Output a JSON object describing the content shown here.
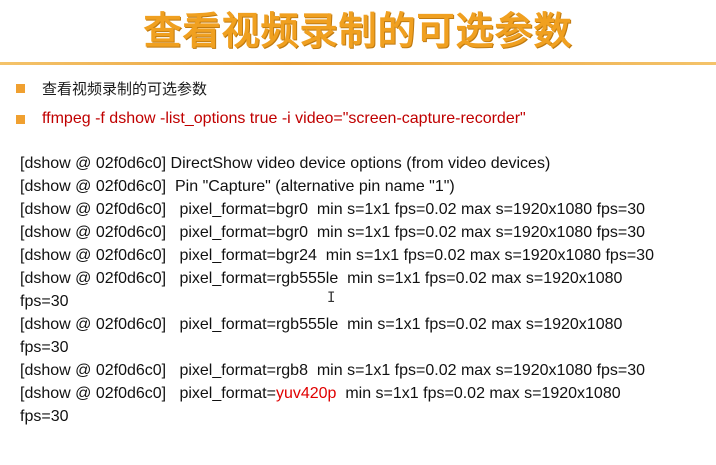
{
  "title": "查看视频录制的可选参数",
  "bullets": [
    "查看视频录制的可选参数",
    "ffmpeg -f dshow -list_options true -i video=\"screen-capture-recorder\""
  ],
  "output_lines": [
    "[dshow @ 02f0d6c0] DirectShow video device options (from video devices)",
    "[dshow @ 02f0d6c0]  Pin \"Capture\" (alternative pin name \"1\")",
    "[dshow @ 02f0d6c0]   pixel_format=bgr0  min s=1x1 fps=0.02 max s=1920x1080 fps=30",
    "[dshow @ 02f0d6c0]   pixel_format=bgr0  min s=1x1 fps=0.02 max s=1920x1080 fps=30",
    "[dshow @ 02f0d6c0]   pixel_format=bgr24  min s=1x1 fps=0.02 max s=1920x1080 fps=30",
    "[dshow @ 02f0d6c0]   pixel_format=rgb555le  min s=1x1 fps=0.02 max s=1920x1080",
    "fps=30",
    "[dshow @ 02f0d6c0]   pixel_format=rgb555le  min s=1x1 fps=0.02 max s=1920x1080",
    "fps=30",
    "[dshow @ 02f0d6c0]   pixel_format=rgb8  min s=1x1 fps=0.02 max s=1920x1080 fps=30"
  ],
  "highlight_line": {
    "prefix": "[dshow @ 02f0d6c0]   pixel_format=",
    "highlight": "yuv420p",
    "suffix": "  min s=1x1 fps=0.02 max s=1920x1080"
  },
  "last_line": "fps=30",
  "colors": {
    "title": "#f0a020",
    "bullet": "#f0a030",
    "command": "#c00000",
    "highlight": "#e00000"
  }
}
